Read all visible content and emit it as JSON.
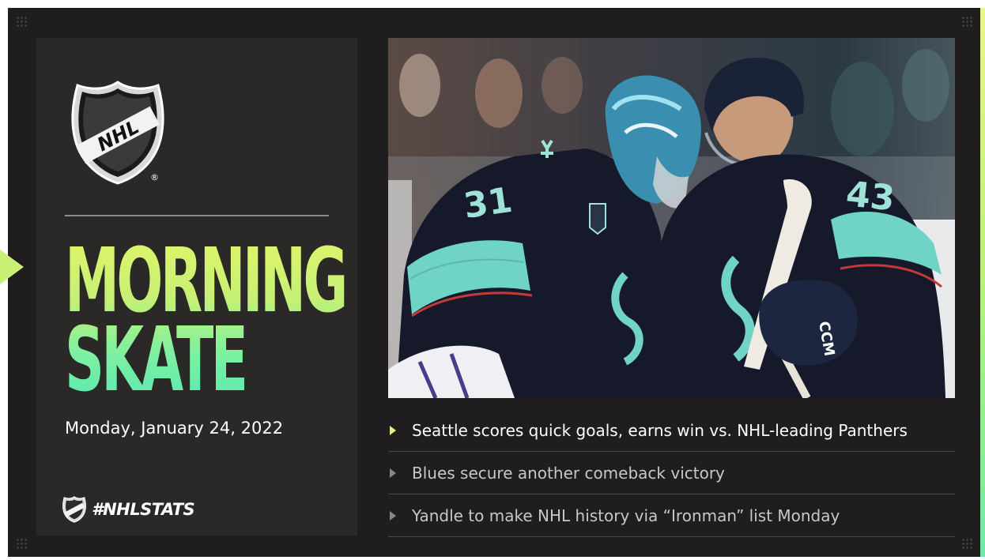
{
  "brand": {
    "logo_text": "NHL",
    "registered_mark": "®",
    "hashtag": "#NHLSTATS"
  },
  "title": {
    "line1": "MORNING",
    "line2": "SKATE"
  },
  "date": "Monday, January 24, 2022",
  "photo": {
    "jersey_numbers": [
      "31",
      "43"
    ],
    "stick_brand": "CCM"
  },
  "headlines": [
    {
      "text": "Seattle scores quick goals, earns win vs. NHL-leading Panthers",
      "active": true
    },
    {
      "text": "Blues secure another comeback victory",
      "active": false
    },
    {
      "text": "Yandle to make NHL history via “Ironman” list Monday",
      "active": false
    }
  ],
  "colors": {
    "background": "#1f1d1d",
    "panel": "#2b2828",
    "accent_yellow": "#dcf56a",
    "accent_green": "#5eeab0",
    "team_navy": "#0f1b2e",
    "team_teal": "#6fd3c5"
  }
}
